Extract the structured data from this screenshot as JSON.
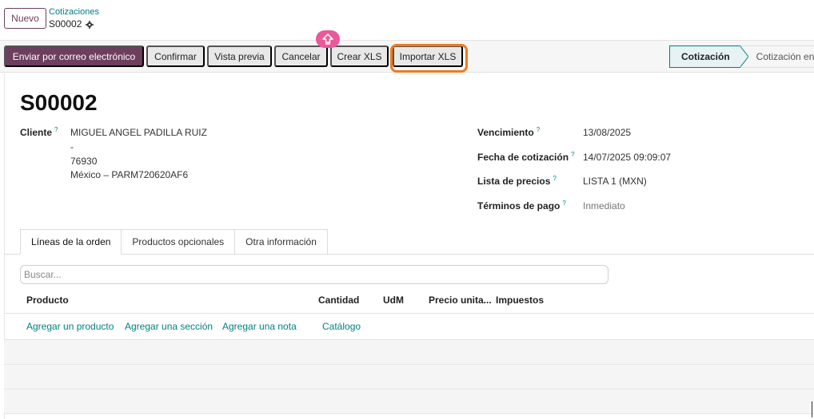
{
  "header": {
    "new_label": "Nuevo",
    "breadcrumb_parent": "Cotizaciones",
    "breadcrumb_current": "S00002"
  },
  "toolbar": {
    "send_email": "Enviar por correo electrónico",
    "confirm": "Confirmar",
    "preview": "Vista previa",
    "cancel": "Cancelar",
    "create_xls": "Crear XLS",
    "import_xls": "Importar XLS"
  },
  "status": {
    "active": "Cotización",
    "next": "Cotización envi"
  },
  "record": {
    "title": "S00002",
    "customer_label": "Cliente",
    "customer_lines": [
      "MIGUEL ANGEL PADILLA RUIZ",
      "-",
      "76930",
      "México – PARM720620AF6"
    ],
    "due_label": "Vencimiento",
    "due_value": "13/08/2025",
    "quote_date_label": "Fecha de cotización",
    "quote_date_value": "14/07/2025 09:09:07",
    "pricelist_label": "Lista de precios",
    "pricelist_value": "LISTA 1 (MXN)",
    "terms_label": "Términos de pago",
    "terms_placeholder": "Inmediato",
    "help_mark": "?"
  },
  "tabs": [
    "Líneas de la orden",
    "Productos opcionales",
    "Otra información"
  ],
  "search": {
    "placeholder": "Buscar..."
  },
  "table": {
    "columns": [
      "Producto",
      "Cantidad",
      "UdM",
      "Precio unita...",
      "Impuestos"
    ],
    "actions": [
      "Agregar un producto",
      "Agregar una sección",
      "Agregar una nota",
      "Catálogo"
    ]
  },
  "colors": {
    "primary": "#6d3e5e",
    "link": "#017e84",
    "highlight": "#f07b1f",
    "badge": "#e85a9a"
  }
}
